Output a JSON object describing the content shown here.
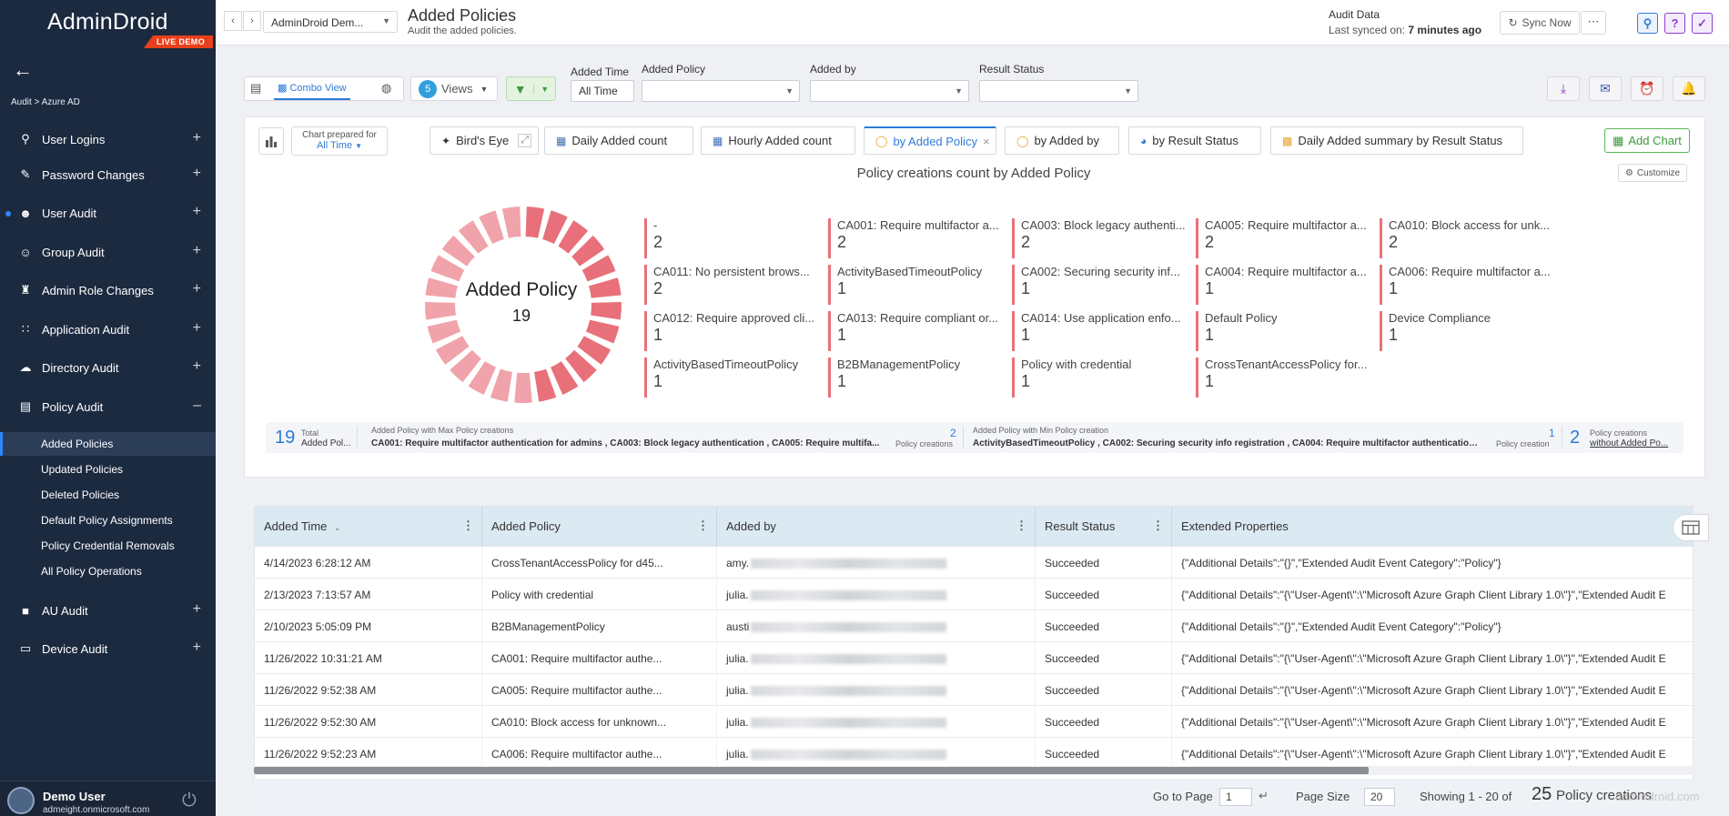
{
  "sidebar": {
    "logo": "AdminDroid",
    "badge": "LIVE DEMO",
    "breadcrumb": "Audit > Azure AD",
    "items": [
      {
        "label": "User Logins",
        "icon": "key-icon"
      },
      {
        "label": "Password Changes",
        "icon": "pencil-icon"
      },
      {
        "label": "User Audit",
        "icon": "user-icon"
      },
      {
        "label": "Group Audit",
        "icon": "group-icon"
      },
      {
        "label": "Admin Role Changes",
        "icon": "shield-icon"
      },
      {
        "label": "Application Audit",
        "icon": "grid-icon"
      },
      {
        "label": "Directory Audit",
        "icon": "cloud-icon"
      },
      {
        "label": "Policy Audit",
        "icon": "policy-icon"
      },
      {
        "label": "AU Audit",
        "icon": "folder-icon"
      },
      {
        "label": "Device Audit",
        "icon": "laptop-icon"
      }
    ],
    "sub_items": [
      "Added Policies",
      "Updated Policies",
      "Deleted Policies",
      "Default Policy Assignments",
      "Policy Credential Removals",
      "All Policy Operations"
    ],
    "user_name": "Demo User",
    "user_email": "admeight.onmicrosoft.com"
  },
  "header": {
    "tenant": "AdminDroid Dem...",
    "title": "Added Policies",
    "subtitle": "Audit the added policies.",
    "audit_data": "Audit Data",
    "last_synced_label": "Last synced on:",
    "last_synced_value": "7 minutes ago",
    "sync_button": "Sync Now"
  },
  "toolbar": {
    "combo_view": "Combo View",
    "views_count": "5",
    "views_label": "Views",
    "filters": {
      "added_time_label": "Added Time",
      "added_time_value": "All Time",
      "added_policy_label": "Added Policy",
      "added_by_label": "Added by",
      "result_status_label": "Result Status"
    }
  },
  "chart_panel": {
    "prepared_label": "Chart prepared for",
    "prepared_value": "All Time",
    "tabs": [
      "Bird's Eye",
      "Daily Added count",
      "Hourly Added count",
      "by Added Policy",
      "by Added by",
      "by Result Status",
      "Daily Added summary by Result Status"
    ],
    "add_chart": "Add Chart",
    "customize": "Customize",
    "summary": {
      "total_num": "19",
      "total_label_1": "Total",
      "total_label_2": "Added Pol...",
      "max_label": "Added Policy with Max Policy creations",
      "max_text": "CA001: Require multifactor authentication for admins , CA003: Block legacy authentication , CA005: Require multifa...",
      "max_num": "2",
      "max_unit": "Policy creations",
      "min_label": "Added Policy with Min Policy creation",
      "min_text": "ActivityBasedTimeoutPolicy , CA002: Securing security info registration , CA004: Require multifactor authentication ...",
      "min_num": "1",
      "min_unit": "Policy creation",
      "without_num": "2",
      "without_label_1": "Policy creations",
      "without_label_2": "without Added Po..."
    }
  },
  "chart_data": {
    "type": "pie",
    "title": "Policy creations count by Added Policy",
    "center_label": "Added Policy",
    "center_value": "19",
    "categories": [
      "-",
      "CA001: Require multifactor a...",
      "CA003: Block legacy authenti...",
      "CA005: Require multifactor a...",
      "CA010: Block access for unk...",
      "CA011: No persistent brows...",
      "ActivityBasedTimeoutPolicy",
      "CA002: Securing security inf...",
      "CA004: Require multifactor a...",
      "CA006: Require multifactor a...",
      "CA012: Require approved cli...",
      "CA013: Require compliant or...",
      "CA014: Use application enfo...",
      "Default Policy",
      "Device Compliance",
      "ActivityBasedTimeoutPolicy",
      "B2BManagementPolicy",
      "Policy with credential",
      "CrossTenantAccessPolicy for..."
    ],
    "values": [
      2,
      2,
      2,
      2,
      2,
      2,
      1,
      1,
      1,
      1,
      1,
      1,
      1,
      1,
      1,
      1,
      1,
      1,
      1
    ]
  },
  "grid": {
    "columns": [
      "Added Time",
      "Added Policy",
      "Added by",
      "Result Status",
      "Extended Properties"
    ],
    "rows": [
      [
        "4/14/2023 6:28:12 AM",
        "CrossTenantAccessPolicy for d45...",
        "amy.",
        "Succeeded",
        "{\"Additional Details\":\"{}\",\"Extended Audit Event Category\":\"Policy\"}"
      ],
      [
        "2/13/2023 7:13:57 AM",
        "Policy with credential",
        "julia.",
        "Succeeded",
        "{\"Additional Details\":\"{\\\"User-Agent\\\":\\\"Microsoft Azure Graph Client Library 1.0\\\"}\",\"Extended Audit E"
      ],
      [
        "2/10/2023 5:05:09 PM",
        "B2BManagementPolicy",
        "austi",
        "Succeeded",
        "{\"Additional Details\":\"{}\",\"Extended Audit Event Category\":\"Policy\"}"
      ],
      [
        "11/26/2022 10:31:21 AM",
        "CA001: Require multifactor authe...",
        "julia.",
        "Succeeded",
        "{\"Additional Details\":\"{\\\"User-Agent\\\":\\\"Microsoft Azure Graph Client Library 1.0\\\"}\",\"Extended Audit E"
      ],
      [
        "11/26/2022 9:52:38 AM",
        "CA005: Require multifactor authe...",
        "julia.",
        "Succeeded",
        "{\"Additional Details\":\"{\\\"User-Agent\\\":\\\"Microsoft Azure Graph Client Library 1.0\\\"}\",\"Extended Audit E"
      ],
      [
        "11/26/2022 9:52:30 AM",
        "CA010: Block access for unknown...",
        "julia.",
        "Succeeded",
        "{\"Additional Details\":\"{\\\"User-Agent\\\":\\\"Microsoft Azure Graph Client Library 1.0\\\"}\",\"Extended Audit E"
      ],
      [
        "11/26/2022 9:52:23 AM",
        "CA006: Require multifactor authe...",
        "julia.",
        "Succeeded",
        "{\"Additional Details\":\"{\\\"User-Agent\\\":\\\"Microsoft Azure Graph Client Library 1.0\\\"}\",\"Extended Audit E"
      ]
    ]
  },
  "pager": {
    "goto_label": "Go to Page",
    "page": "1",
    "page_size_label": "Page Size",
    "page_size": "20",
    "showing_prefix": "Showing 1 - 20 of",
    "total": "25",
    "showing_suffix": "Policy creations"
  },
  "watermark": "admindroid.com",
  "colors": {
    "sidebar_bg": "#1c2a40",
    "accent_blue": "#2f7bd8",
    "donut_a": "#e8707a",
    "donut_b": "#f0a3aa",
    "live_demo": "#e8401c"
  }
}
